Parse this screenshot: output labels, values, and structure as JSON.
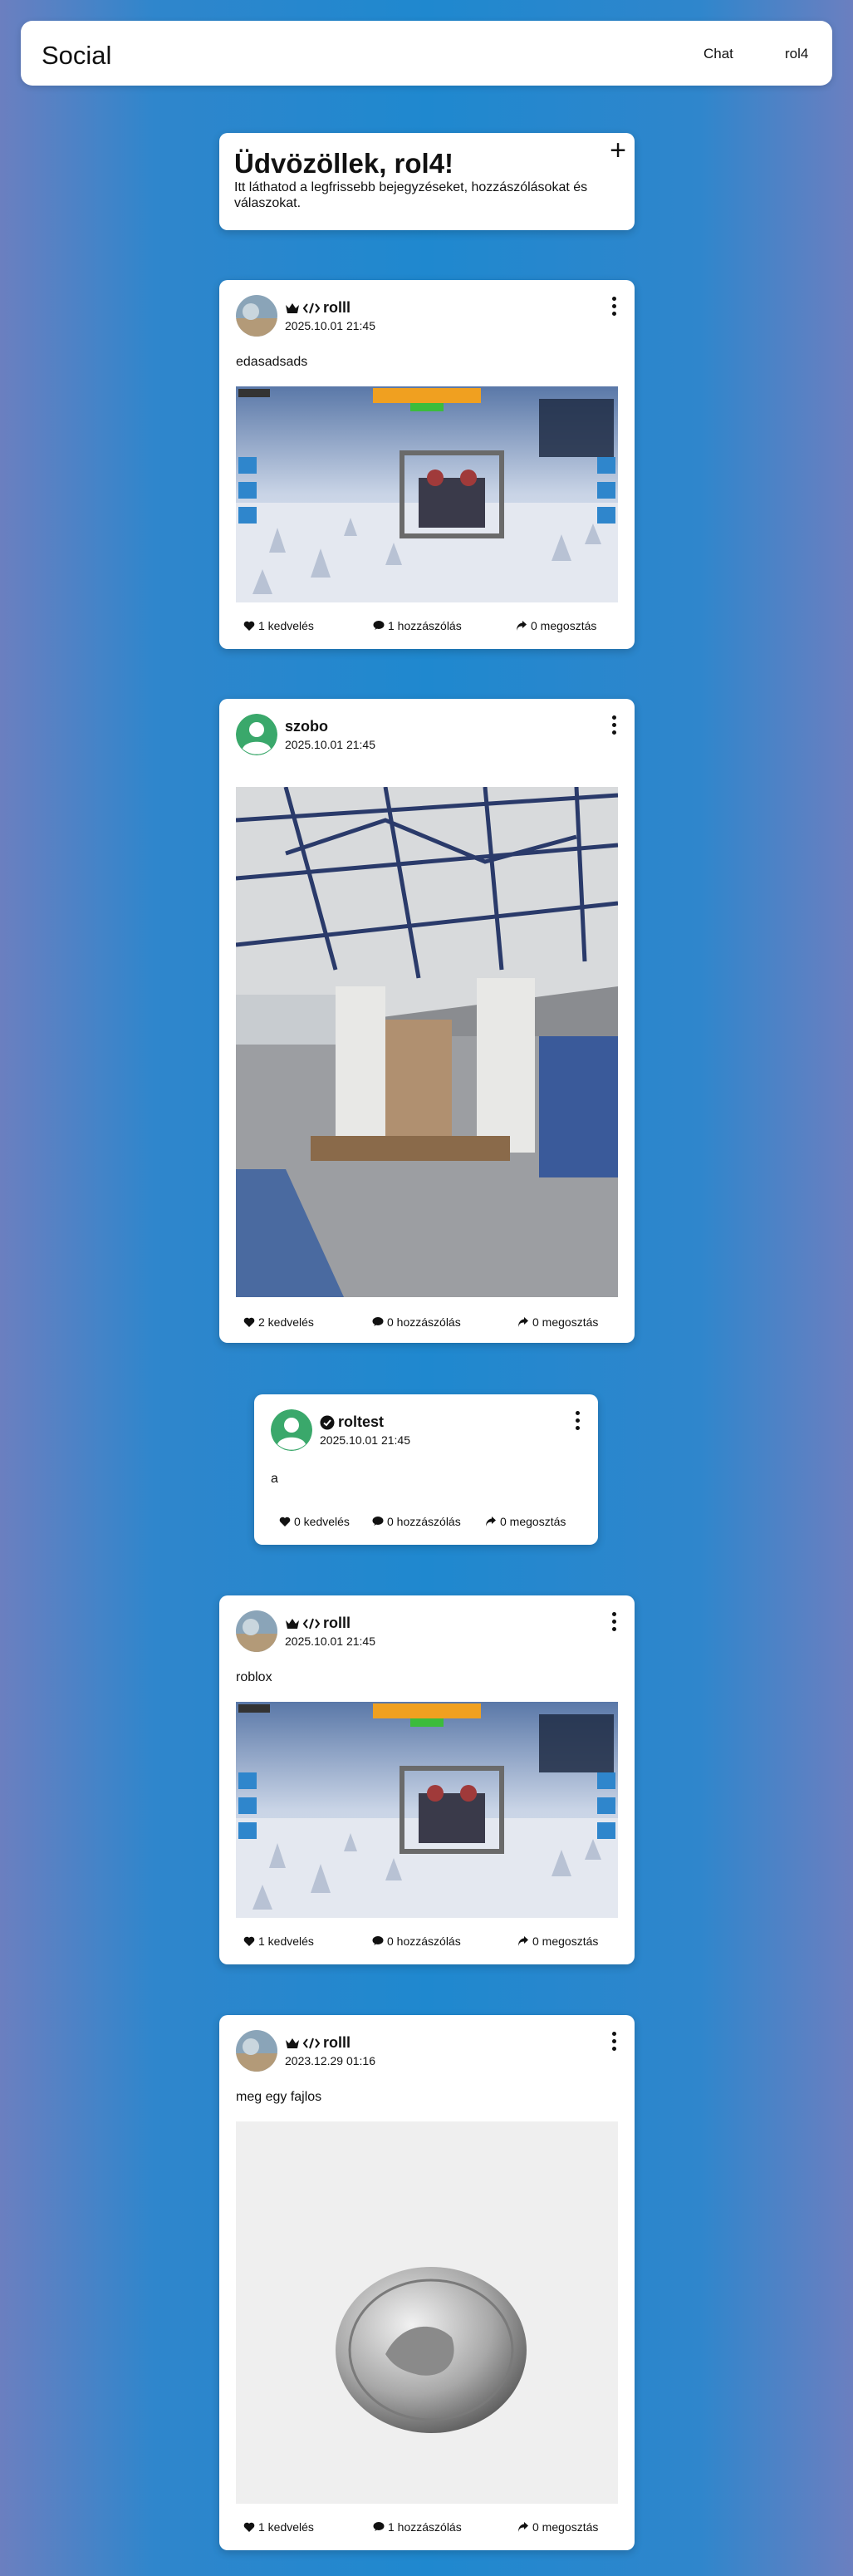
{
  "nav": {
    "brand": "Social",
    "chat": "Chat",
    "user": "rol4"
  },
  "welcome": {
    "title": "Üdvözöllek, rol4!",
    "subtitle": "Itt láthatod a legfrissebb bejegyzéseket, hozzászólásokat és válaszokat.",
    "add_label": "+"
  },
  "posts": [
    {
      "author": "rolll",
      "date": "2025.10.01 21:45",
      "text": "edasadsads",
      "image": "game-screenshot",
      "likes": "1 kedvelés",
      "comments": "1 hozzászólás",
      "shares": "0 megosztás"
    },
    {
      "author": "szobo",
      "date": "2025.10.01 21:45",
      "text": "",
      "image": "warehouse-photo",
      "likes": "2 kedvelés",
      "comments": "0 hozzászólás",
      "shares": "0 megosztás"
    },
    {
      "author": "roltest",
      "date": "2025.10.01 21:45",
      "text": "a",
      "image": "",
      "likes": "0 kedvelés",
      "comments": "0 hozzászólás",
      "shares": "0 megosztás"
    },
    {
      "author": "rolll",
      "date": "2025.10.01 21:45",
      "text": "roblox",
      "image": "game-screenshot",
      "likes": "1 kedvelés",
      "comments": "0 hozzászólás",
      "shares": "0 megosztás"
    },
    {
      "author": "rolll",
      "date": "2023.12.29 01:16",
      "text": "meg egy fajlos",
      "image": "button-photo",
      "likes": "1 kedvelés",
      "comments": "1 hozzászólás",
      "shares": "0 megosztás"
    }
  ],
  "icons": {
    "like": "heart-icon",
    "comment": "comment-icon",
    "share": "share-icon",
    "crown": "crown-icon",
    "code": "code-icon",
    "verified": "verified-icon",
    "menu": "kebab-menu-icon"
  },
  "colors": {
    "background": "#1f88cf",
    "card": "#ffffff",
    "default_avatar": "#3aa86b"
  }
}
